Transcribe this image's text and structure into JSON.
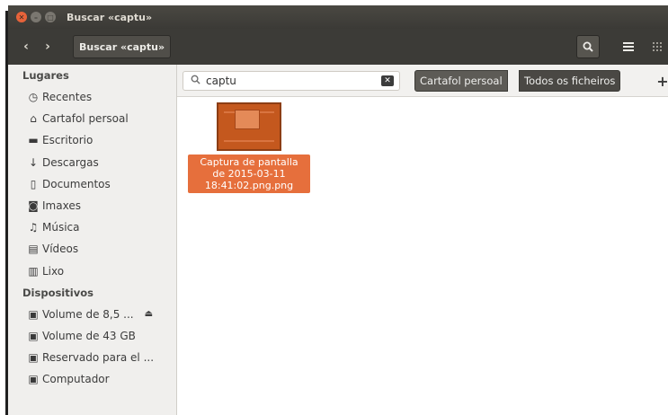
{
  "window": {
    "title": "Buscar «captu»"
  },
  "toolbar": {
    "path_label": "Buscar «captu»"
  },
  "sidebar": {
    "places_title": "Lugares",
    "places": [
      {
        "label": "Recentes",
        "icon": "clock-icon"
      },
      {
        "label": "Cartafol persoal",
        "icon": "home-icon"
      },
      {
        "label": "Escritorio",
        "icon": "desktop-folder-icon"
      },
      {
        "label": "Descargas",
        "icon": "download-icon"
      },
      {
        "label": "Documentos",
        "icon": "document-icon"
      },
      {
        "label": "Imaxes",
        "icon": "camera-icon"
      },
      {
        "label": "Música",
        "icon": "music-icon"
      },
      {
        "label": "Vídeos",
        "icon": "film-icon"
      },
      {
        "label": "Lixo",
        "icon": "trash-icon"
      }
    ],
    "devices_title": "Dispositivos",
    "devices": [
      {
        "label": "Volume de 8,5 ...",
        "icon": "drive-icon"
      },
      {
        "label": "Volume de 43 GB",
        "icon": "drive-icon"
      },
      {
        "label": "Reservado para el ...",
        "icon": "drive-icon"
      },
      {
        "label": "Computador",
        "icon": "drive-icon"
      }
    ]
  },
  "search": {
    "query": "captu"
  },
  "location": {
    "home_label": "Cartafol persoal",
    "all_label": "Todos os ficheiros"
  },
  "files": [
    {
      "name": "Captura de pantalla de 2015-03-11 18:41:02.png.png",
      "line1": "Captura de pantalla",
      "line2": "de 2015-03-11",
      "line3": "18:41:02.png.png"
    }
  ],
  "colors": {
    "accent": "#e66f3c",
    "titlebar": "#3c3b37",
    "sidebar_bg": "#f0efed"
  }
}
